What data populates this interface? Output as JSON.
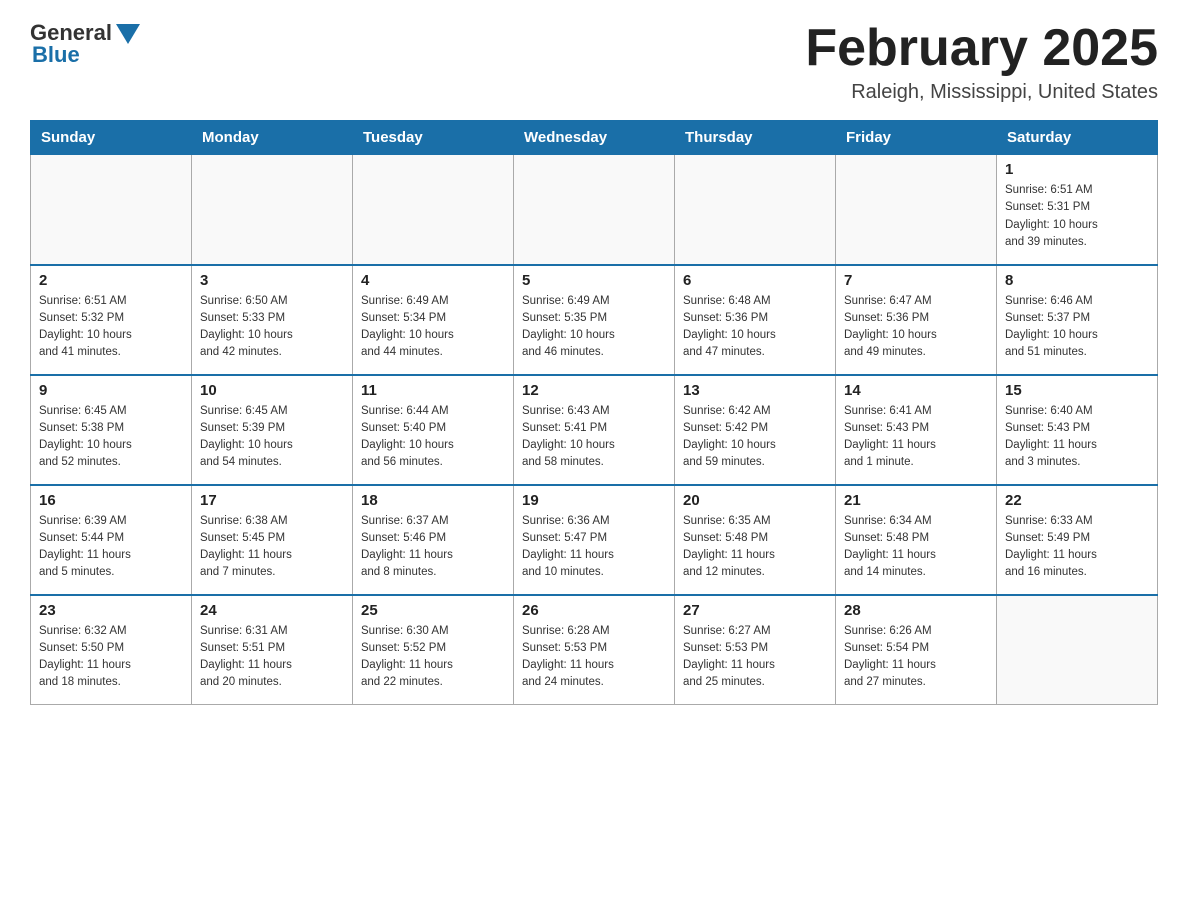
{
  "header": {
    "logo_general": "General",
    "logo_blue": "Blue",
    "month_title": "February 2025",
    "location": "Raleigh, Mississippi, United States"
  },
  "weekdays": [
    "Sunday",
    "Monday",
    "Tuesday",
    "Wednesday",
    "Thursday",
    "Friday",
    "Saturday"
  ],
  "weeks": [
    [
      {
        "day": "",
        "info": ""
      },
      {
        "day": "",
        "info": ""
      },
      {
        "day": "",
        "info": ""
      },
      {
        "day": "",
        "info": ""
      },
      {
        "day": "",
        "info": ""
      },
      {
        "day": "",
        "info": ""
      },
      {
        "day": "1",
        "info": "Sunrise: 6:51 AM\nSunset: 5:31 PM\nDaylight: 10 hours\nand 39 minutes."
      }
    ],
    [
      {
        "day": "2",
        "info": "Sunrise: 6:51 AM\nSunset: 5:32 PM\nDaylight: 10 hours\nand 41 minutes."
      },
      {
        "day": "3",
        "info": "Sunrise: 6:50 AM\nSunset: 5:33 PM\nDaylight: 10 hours\nand 42 minutes."
      },
      {
        "day": "4",
        "info": "Sunrise: 6:49 AM\nSunset: 5:34 PM\nDaylight: 10 hours\nand 44 minutes."
      },
      {
        "day": "5",
        "info": "Sunrise: 6:49 AM\nSunset: 5:35 PM\nDaylight: 10 hours\nand 46 minutes."
      },
      {
        "day": "6",
        "info": "Sunrise: 6:48 AM\nSunset: 5:36 PM\nDaylight: 10 hours\nand 47 minutes."
      },
      {
        "day": "7",
        "info": "Sunrise: 6:47 AM\nSunset: 5:36 PM\nDaylight: 10 hours\nand 49 minutes."
      },
      {
        "day": "8",
        "info": "Sunrise: 6:46 AM\nSunset: 5:37 PM\nDaylight: 10 hours\nand 51 minutes."
      }
    ],
    [
      {
        "day": "9",
        "info": "Sunrise: 6:45 AM\nSunset: 5:38 PM\nDaylight: 10 hours\nand 52 minutes."
      },
      {
        "day": "10",
        "info": "Sunrise: 6:45 AM\nSunset: 5:39 PM\nDaylight: 10 hours\nand 54 minutes."
      },
      {
        "day": "11",
        "info": "Sunrise: 6:44 AM\nSunset: 5:40 PM\nDaylight: 10 hours\nand 56 minutes."
      },
      {
        "day": "12",
        "info": "Sunrise: 6:43 AM\nSunset: 5:41 PM\nDaylight: 10 hours\nand 58 minutes."
      },
      {
        "day": "13",
        "info": "Sunrise: 6:42 AM\nSunset: 5:42 PM\nDaylight: 10 hours\nand 59 minutes."
      },
      {
        "day": "14",
        "info": "Sunrise: 6:41 AM\nSunset: 5:43 PM\nDaylight: 11 hours\nand 1 minute."
      },
      {
        "day": "15",
        "info": "Sunrise: 6:40 AM\nSunset: 5:43 PM\nDaylight: 11 hours\nand 3 minutes."
      }
    ],
    [
      {
        "day": "16",
        "info": "Sunrise: 6:39 AM\nSunset: 5:44 PM\nDaylight: 11 hours\nand 5 minutes."
      },
      {
        "day": "17",
        "info": "Sunrise: 6:38 AM\nSunset: 5:45 PM\nDaylight: 11 hours\nand 7 minutes."
      },
      {
        "day": "18",
        "info": "Sunrise: 6:37 AM\nSunset: 5:46 PM\nDaylight: 11 hours\nand 8 minutes."
      },
      {
        "day": "19",
        "info": "Sunrise: 6:36 AM\nSunset: 5:47 PM\nDaylight: 11 hours\nand 10 minutes."
      },
      {
        "day": "20",
        "info": "Sunrise: 6:35 AM\nSunset: 5:48 PM\nDaylight: 11 hours\nand 12 minutes."
      },
      {
        "day": "21",
        "info": "Sunrise: 6:34 AM\nSunset: 5:48 PM\nDaylight: 11 hours\nand 14 minutes."
      },
      {
        "day": "22",
        "info": "Sunrise: 6:33 AM\nSunset: 5:49 PM\nDaylight: 11 hours\nand 16 minutes."
      }
    ],
    [
      {
        "day": "23",
        "info": "Sunrise: 6:32 AM\nSunset: 5:50 PM\nDaylight: 11 hours\nand 18 minutes."
      },
      {
        "day": "24",
        "info": "Sunrise: 6:31 AM\nSunset: 5:51 PM\nDaylight: 11 hours\nand 20 minutes."
      },
      {
        "day": "25",
        "info": "Sunrise: 6:30 AM\nSunset: 5:52 PM\nDaylight: 11 hours\nand 22 minutes."
      },
      {
        "day": "26",
        "info": "Sunrise: 6:28 AM\nSunset: 5:53 PM\nDaylight: 11 hours\nand 24 minutes."
      },
      {
        "day": "27",
        "info": "Sunrise: 6:27 AM\nSunset: 5:53 PM\nDaylight: 11 hours\nand 25 minutes."
      },
      {
        "day": "28",
        "info": "Sunrise: 6:26 AM\nSunset: 5:54 PM\nDaylight: 11 hours\nand 27 minutes."
      },
      {
        "day": "",
        "info": ""
      }
    ]
  ]
}
